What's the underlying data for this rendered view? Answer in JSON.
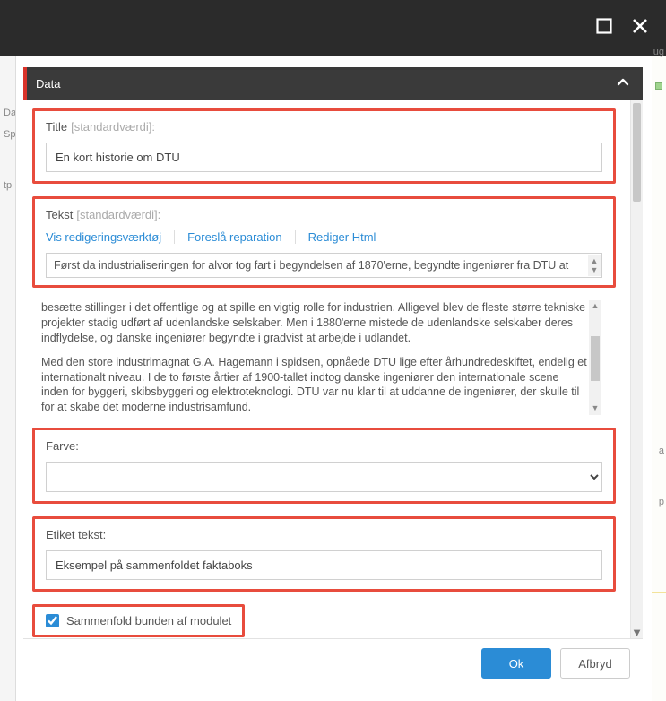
{
  "window": {
    "maximize_icon": "maximize",
    "close_icon": "close"
  },
  "panel": {
    "title": "Data",
    "chevron_icon": "chevron-up"
  },
  "title_field": {
    "label": "Title",
    "std": "[standardværdi]:",
    "value": "En kort historie om DTU"
  },
  "text_field": {
    "label": "Tekst",
    "std": "[standardværdi]:",
    "toolbar": {
      "show_editor": "Vis redigeringsværktøj",
      "suggest_fix": "Foreslå reparation",
      "edit_html": "Rediger Html"
    },
    "visible_line": "Først da industrialiseringen for alvor tog fart i begyndelsen af 1870'erne, begyndte ingeniører fra DTU at",
    "overflow_p1": "besætte stillinger i det offentlige og at spille en vigtig rolle for industrien. Alligevel blev de fleste større tekniske projekter stadig udført af udenlandske selskaber. Men i 1880'erne mistede de udenlandske selskaber deres indflydelse, og danske ingeniører begyndte i gradvist at arbejde i udlandet.",
    "overflow_p2": "Med den store industrimagnat G.A. Hagemann i spidsen, opnåede DTU lige efter århundredeskiftet, endelig et internationalt niveau. I de to første årtier af 1900-tallet indtog danske ingeniører den internationale scene inden for byggeri, skibsbyggeri og elektroteknologi. DTU var nu klar til at uddanne de ingeniører, der skulle til for at skabe det moderne industrisamfund."
  },
  "color_field": {
    "label": "Farve:",
    "value": ""
  },
  "etiket_field": {
    "label": "Etiket tekst:",
    "value": "Eksempel på sammenfoldet faktaboks"
  },
  "collapse_checkbox": {
    "label": "Sammenfold bunden af modulet",
    "checked": true
  },
  "footer": {
    "ok": "Ok",
    "cancel": "Afbryd"
  },
  "bg_labels": {
    "da": "Da",
    "sp": "Sp",
    "tp": "tp",
    "a": "a",
    "p": "p",
    "ug": "ug"
  }
}
